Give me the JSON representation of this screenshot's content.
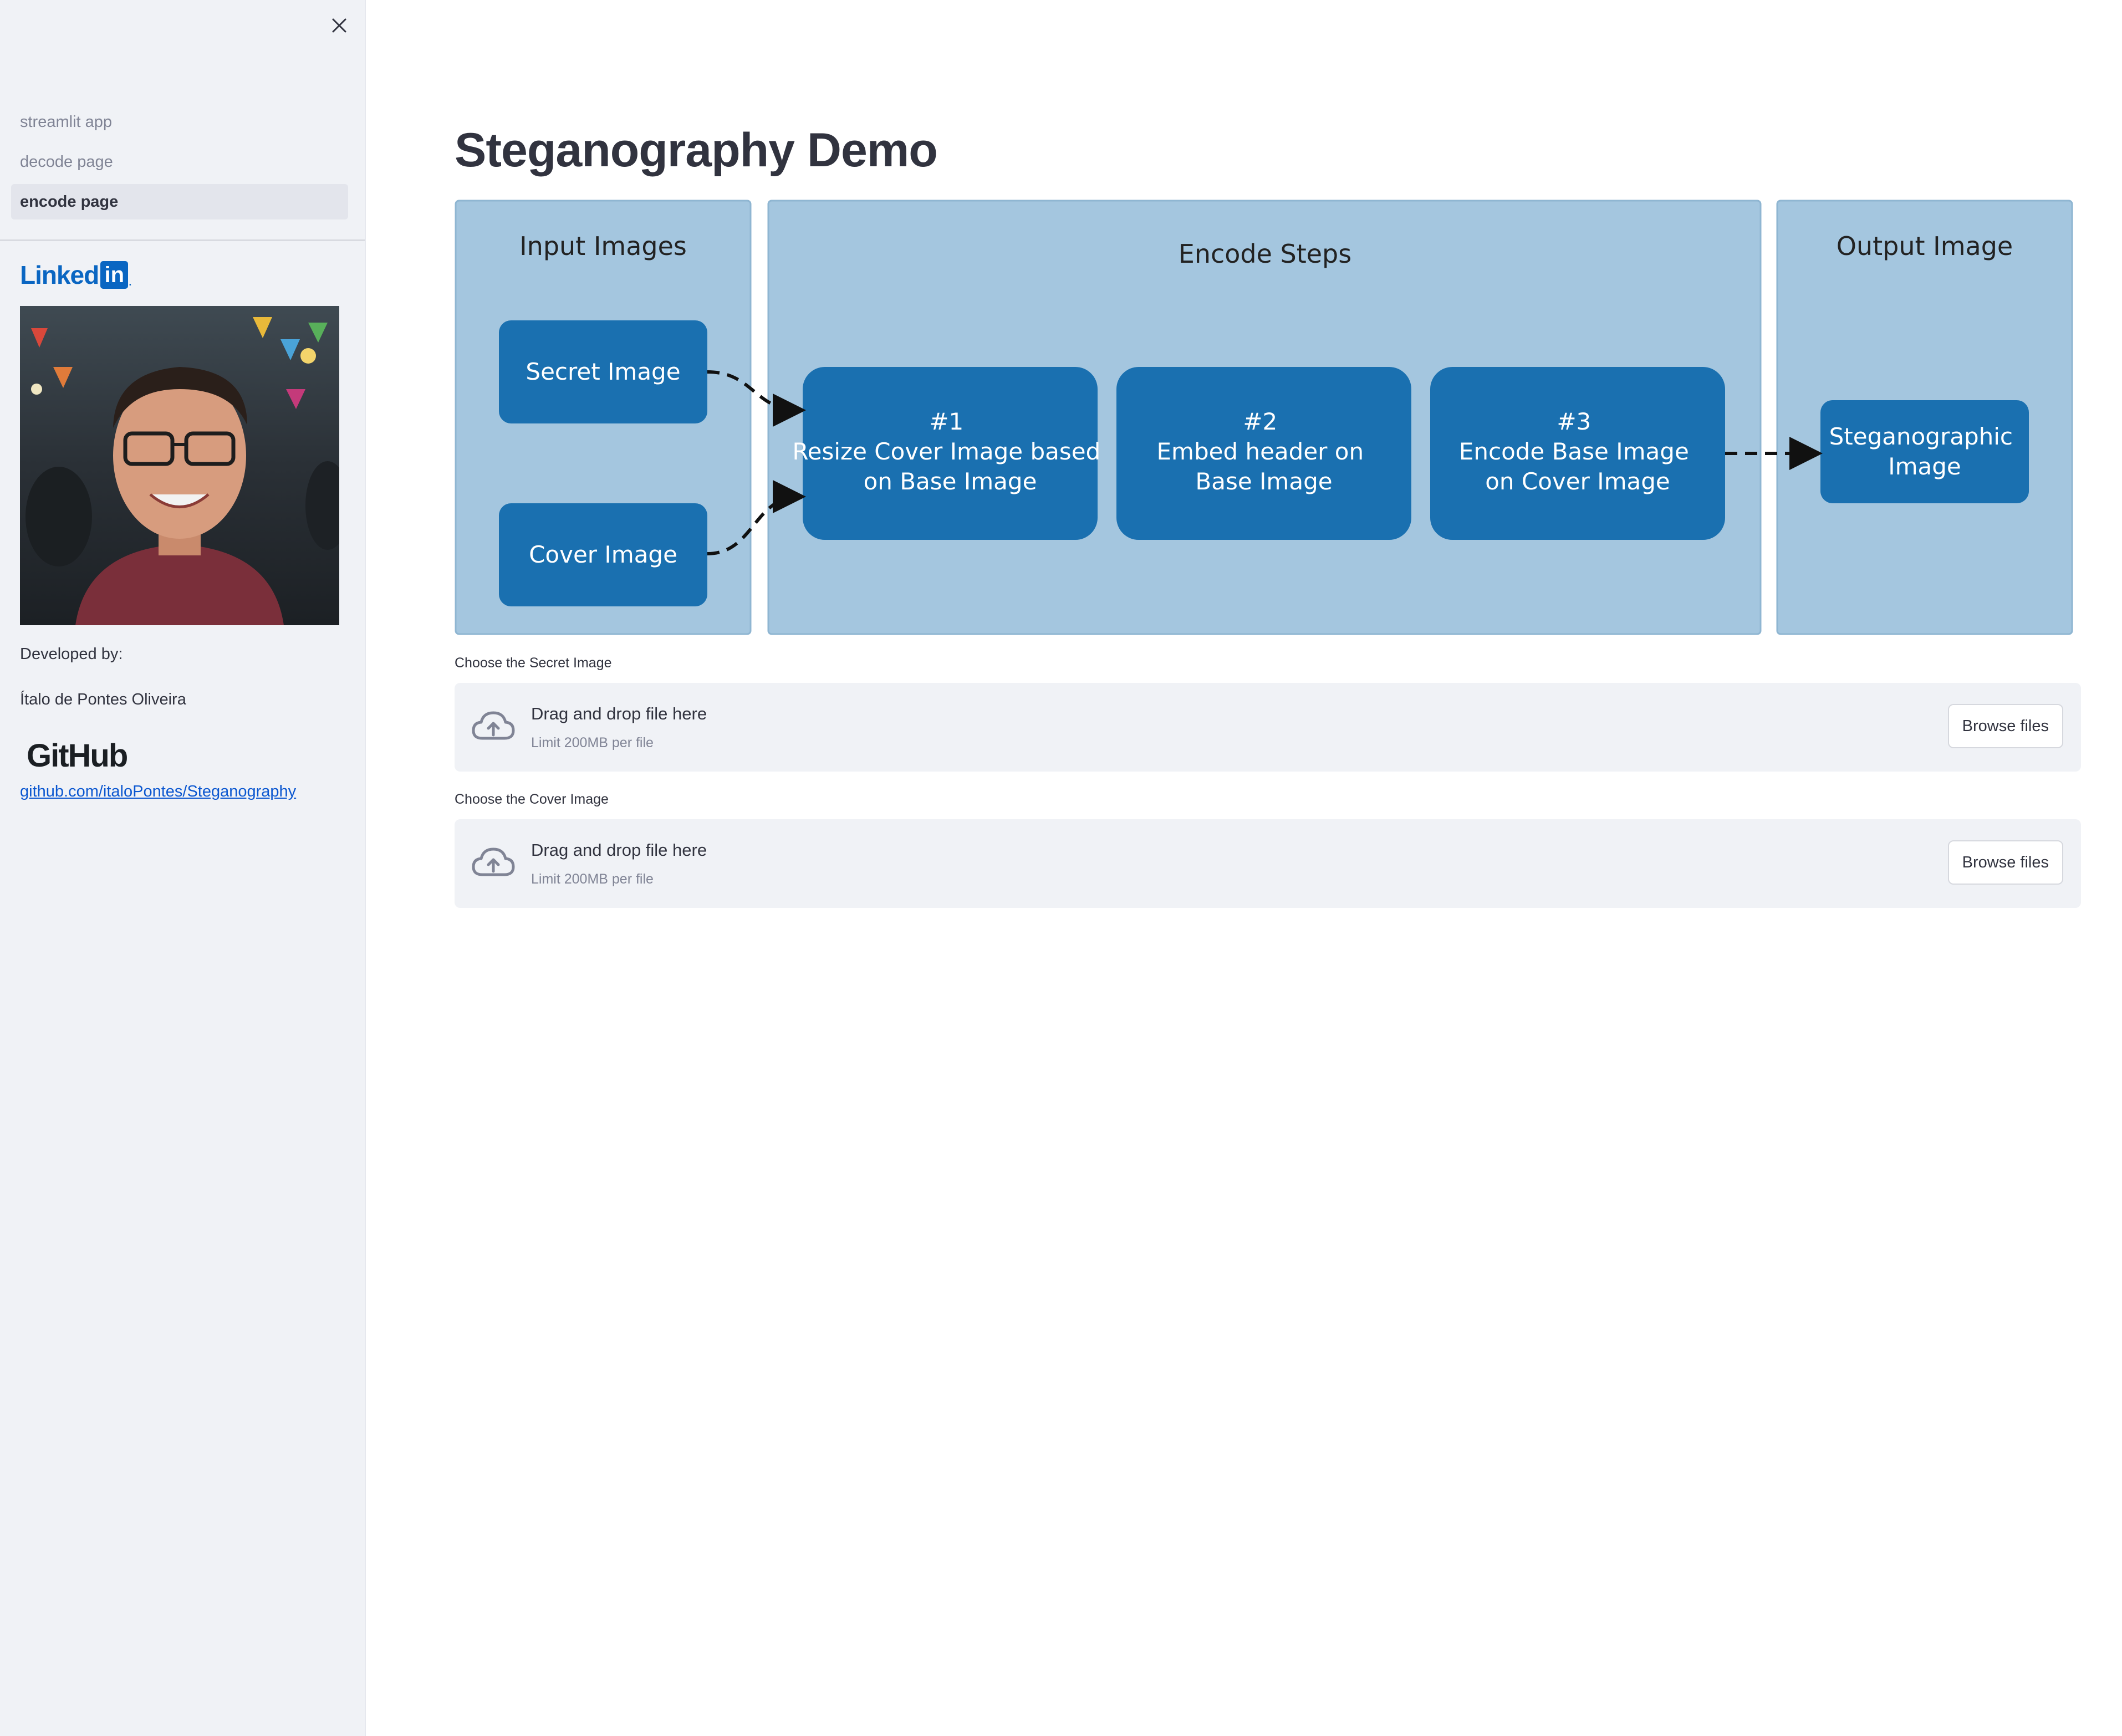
{
  "sidebar": {
    "nav_items": [
      {
        "label": "streamlit app",
        "active": false
      },
      {
        "label": "decode page",
        "active": false
      },
      {
        "label": "encode page",
        "active": true
      }
    ],
    "linkedin": {
      "word": "Linked",
      "box": "in",
      "dot": "."
    },
    "developed_by_label": "Developed by:",
    "developer_name": "Ítalo de Pontes Oliveira",
    "github_logo": "GitHub",
    "github_link": "github.com/italoPontes/Steganography"
  },
  "main": {
    "title": "Steganography Demo",
    "diagram": {
      "input_panel_title": "Input Images",
      "encode_panel_title": "Encode Steps",
      "output_panel_title": "Output Image",
      "secret_image": "Secret Image",
      "cover_image": "Cover Image",
      "step1": {
        "num": "#1",
        "line1": "Resize Cover Image based",
        "line2": "on Base Image"
      },
      "step2": {
        "num": "#2",
        "line1": "Embed header on",
        "line2": "Base Image"
      },
      "step3": {
        "num": "#3",
        "line1": "Encode Base Image",
        "line2": "on Cover Image"
      },
      "output": {
        "line1": "Steganographic",
        "line2": "Image"
      },
      "colors": {
        "panel": "#a4c6df",
        "box": "#1a70b0",
        "text": "#ffffff"
      }
    },
    "uploaders": [
      {
        "label": "Choose the Secret Image",
        "drop_text": "Drag and drop file here",
        "limit": "Limit 200MB per file",
        "button": "Browse files"
      },
      {
        "label": "Choose the Cover Image",
        "drop_text": "Drag and drop file here",
        "limit": "Limit 200MB per file",
        "button": "Browse files"
      }
    ]
  },
  "icons": [
    "close-icon",
    "upload-cloud-icon"
  ]
}
